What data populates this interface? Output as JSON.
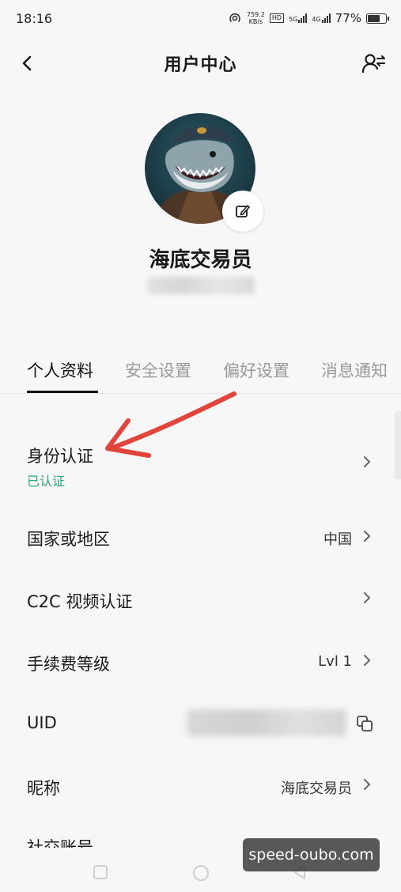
{
  "status_bar": {
    "time": "18:16",
    "net_speed_value": "759.2",
    "net_speed_unit": "KB/s",
    "hd_tag": "HD",
    "signal_1": "5G",
    "signal_2": "4G",
    "battery": "77%",
    "battery_level": 0.77
  },
  "header": {
    "title": "用户中心",
    "back_icon": "chevron-left-icon",
    "switch_icon": "user-switch-icon"
  },
  "profile": {
    "name": "海底交易员",
    "edit_icon": "edit-icon"
  },
  "tabs": [
    {
      "label": "个人资料",
      "active": true
    },
    {
      "label": "安全设置",
      "active": false
    },
    {
      "label": "偏好设置",
      "active": false
    },
    {
      "label": "消息通知",
      "active": false
    }
  ],
  "rows": {
    "identity": {
      "label": "身份认证",
      "status": "已认证"
    },
    "country": {
      "label": "国家或地区",
      "value": "中国"
    },
    "c2c": {
      "label": "C2C 视频认证"
    },
    "fee": {
      "label": "手续费等级",
      "value": "Lvl 1"
    },
    "uid": {
      "label": "UID",
      "copy_icon": "copy-icon"
    },
    "nickname": {
      "label": "昵称",
      "value": "海底交易员"
    },
    "social": {
      "label": "社交账号"
    }
  },
  "watermark": "speed-oubo.com",
  "colors": {
    "verified": "#2aa876",
    "arrow": "#e0443a",
    "background": "#f7f7f7"
  }
}
